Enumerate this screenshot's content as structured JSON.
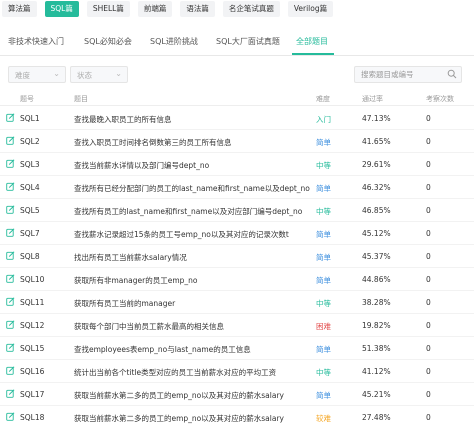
{
  "top_tabs": [
    {
      "label": "算法篇",
      "active": false
    },
    {
      "label": "SQL篇",
      "active": true
    },
    {
      "label": "SHELL篇",
      "active": false
    },
    {
      "label": "前端篇",
      "active": false
    },
    {
      "label": "语法篇",
      "active": false
    },
    {
      "label": "名企笔试真题",
      "active": false
    },
    {
      "label": "Verilog篇",
      "active": false
    }
  ],
  "sub_tabs": [
    {
      "label": "非技术快速入门",
      "active": false
    },
    {
      "label": "SQL必知必会",
      "active": false
    },
    {
      "label": "SQL进阶挑战",
      "active": false
    },
    {
      "label": "SQL大厂面试真题",
      "active": false
    },
    {
      "label": "全部题目",
      "active": true
    }
  ],
  "filters": {
    "difficulty_placeholder": "难度",
    "status_placeholder": "状态",
    "search_placeholder": "搜索题目或编号"
  },
  "table": {
    "headers": {
      "number": "题号",
      "title": "题目",
      "difficulty": "难度",
      "pass_rate": "通过率",
      "attempts": "考察次数"
    },
    "rows": [
      {
        "id": "SQL1",
        "title": "查找最晚入职员工的所有信息",
        "difficulty": "入门",
        "level": "entry",
        "rate": "47.13%",
        "count": "0"
      },
      {
        "id": "SQL2",
        "title": "查找入职员工时间排名倒数第三的员工所有信息",
        "difficulty": "简单",
        "level": "easy",
        "rate": "41.65%",
        "count": "0"
      },
      {
        "id": "SQL3",
        "title": "查找当前薪水详情以及部门编号dept_no",
        "difficulty": "中等",
        "level": "medium",
        "rate": "29.61%",
        "count": "0"
      },
      {
        "id": "SQL4",
        "title": "查找所有已经分配部门的员工的last_name和first_name以及dept_no",
        "difficulty": "简单",
        "level": "easy",
        "rate": "46.32%",
        "count": "0"
      },
      {
        "id": "SQL5",
        "title": "查找所有员工的last_name和first_name以及对应部门编号dept_no",
        "difficulty": "中等",
        "level": "medium",
        "rate": "46.85%",
        "count": "0"
      },
      {
        "id": "SQL7",
        "title": "查找薪水记录超过15条的员工号emp_no以及其对应的记录次数t",
        "difficulty": "简单",
        "level": "easy",
        "rate": "45.12%",
        "count": "0"
      },
      {
        "id": "SQL8",
        "title": "找出所有员工当前薪水salary情况",
        "difficulty": "简单",
        "level": "easy",
        "rate": "45.37%",
        "count": "0"
      },
      {
        "id": "SQL10",
        "title": "获取所有非manager的员工emp_no",
        "difficulty": "简单",
        "level": "easy",
        "rate": "44.86%",
        "count": "0"
      },
      {
        "id": "SQL11",
        "title": "获取所有员工当前的manager",
        "difficulty": "中等",
        "level": "medium",
        "rate": "38.28%",
        "count": "0"
      },
      {
        "id": "SQL12",
        "title": "获取每个部门中当前员工薪水最高的相关信息",
        "difficulty": "困难",
        "level": "hard",
        "rate": "19.82%",
        "count": "0"
      },
      {
        "id": "SQL15",
        "title": "查找employees表emp_no与last_name的员工信息",
        "difficulty": "简单",
        "level": "easy",
        "rate": "51.38%",
        "count": "0"
      },
      {
        "id": "SQL16",
        "title": "统计出当前各个title类型对应的员工当前薪水对应的平均工资",
        "difficulty": "中等",
        "level": "medium",
        "rate": "41.12%",
        "count": "0"
      },
      {
        "id": "SQL17",
        "title": "获取当前薪水第二多的员工的emp_no以及其对应的薪水salary",
        "difficulty": "简单",
        "level": "easy",
        "rate": "45.21%",
        "count": "0"
      },
      {
        "id": "SQL18",
        "title": "获取当前薪水第二多的员工的emp_no以及其对应的薪水salary",
        "difficulty": "较难",
        "level": "tough",
        "rate": "27.48%",
        "count": "0"
      }
    ]
  },
  "colors": {
    "accent": "#25bb9b",
    "easy": "#3d8fde",
    "hard": "#e34c4c",
    "tough": "#f5a623"
  }
}
